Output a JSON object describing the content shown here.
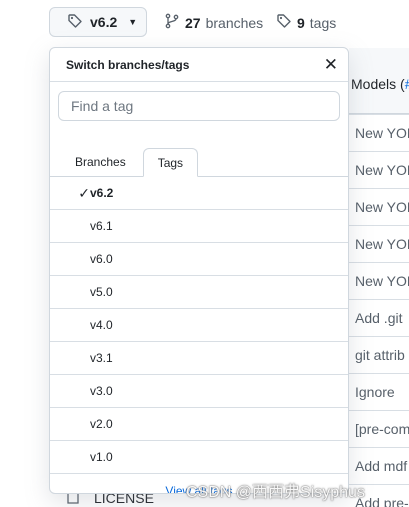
{
  "toolbar": {
    "ref_label": "v6.2",
    "branches_count": "27",
    "branches_label": "branches",
    "tags_count": "9",
    "tags_label": "tags"
  },
  "background": {
    "header_text": "Models (",
    "header_accent": "#",
    "rows": [
      "New YOL",
      "New YOL",
      "New YOL",
      "New YOL",
      "New YOL",
      "Add .git",
      "git attrib",
      "Ignore",
      "[pre-com",
      "Add mdf",
      "Add pre-"
    ],
    "license_name": "LICENSE"
  },
  "dropdown": {
    "title": "Switch branches/tags",
    "filter_placeholder": "Find a tag",
    "tabs": [
      "Branches",
      "Tags"
    ],
    "active_tab": "Tags",
    "tags": [
      "v6.2",
      "v6.1",
      "v6.0",
      "v5.0",
      "v4.0",
      "v3.1",
      "v3.0",
      "v2.0",
      "v1.0"
    ],
    "selected_tag": "v6.2",
    "footer_link": "View all tags"
  },
  "watermark": "CSDN @西西弗Sisyphus",
  "colors": {
    "link": "#0969da",
    "border": "#d0d7de",
    "text": "#1f2328"
  }
}
